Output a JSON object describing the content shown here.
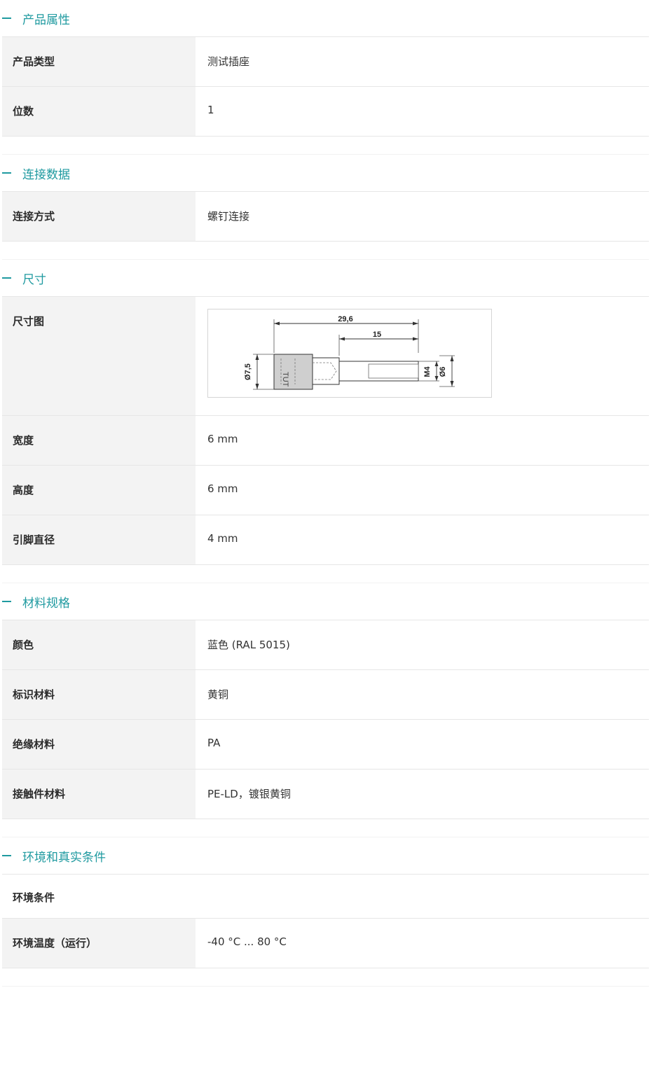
{
  "sections": [
    {
      "title": "产品属性",
      "rows": [
        {
          "key": "产品类型",
          "value": "测试插座"
        },
        {
          "key": "位数",
          "value": "1"
        }
      ]
    },
    {
      "title": "连接数据",
      "rows": [
        {
          "key": "连接方式",
          "value": "螺钉连接"
        }
      ]
    },
    {
      "title": "尺寸",
      "rows": [
        {
          "key": "尺寸图",
          "value": ""
        },
        {
          "key": "宽度",
          "value": "6 mm"
        },
        {
          "key": "高度",
          "value": "6 mm"
        },
        {
          "key": "引脚直径",
          "value": "4 mm"
        }
      ],
      "drawing": {
        "overall_length": "29,6",
        "thread_length": "15",
        "head_diameter": "Ø7,5",
        "thread": "M4",
        "diameter": "Ø6"
      }
    },
    {
      "title": "材料规格",
      "rows": [
        {
          "key": "颜色",
          "value": "蓝色 (RAL 5015)"
        },
        {
          "key": "标识材料",
          "value": "黄铜"
        },
        {
          "key": "绝缘材料",
          "value": "PA"
        },
        {
          "key": "接触件材料",
          "value": "PE-LD，镀银黄铜"
        }
      ]
    },
    {
      "title": "环境和真实条件",
      "rows": [
        {
          "key": "环境条件",
          "value": ""
        },
        {
          "key": "环境温度（运行）",
          "value": "-40 °C ... 80 °C"
        }
      ]
    }
  ]
}
